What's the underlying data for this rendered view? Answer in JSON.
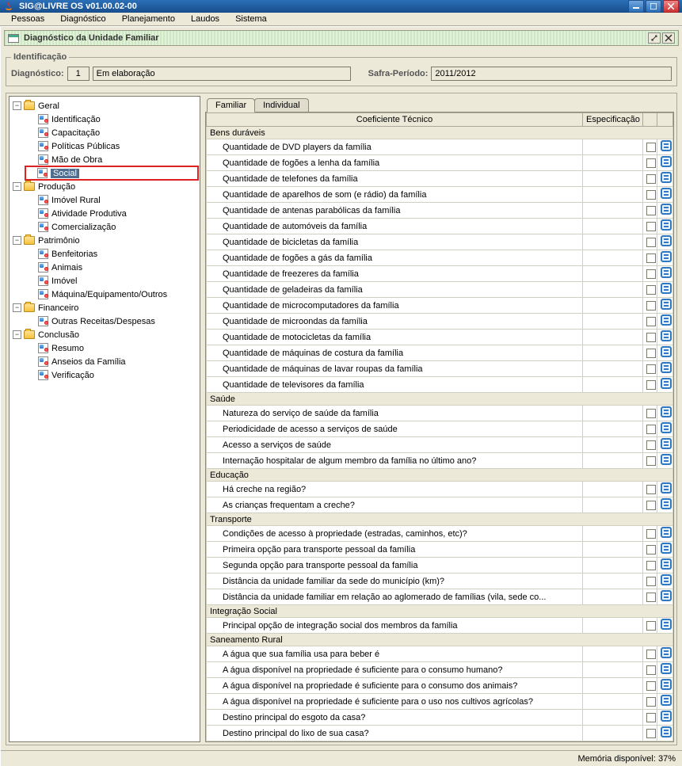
{
  "window": {
    "title": "SIG@LIVRE OS v01.00.02-00"
  },
  "menubar": [
    "Pessoas",
    "Diagnóstico",
    "Planejamento",
    "Laudos",
    "Sistema"
  ],
  "iframe": {
    "title": "Diagnóstico da Unidade Familiar"
  },
  "ident": {
    "legend": "Identificação",
    "diag_label": "Diagnóstico:",
    "diag_num": "1",
    "diag_status": "Em elaboração",
    "safra_label": "Safra-Período:",
    "safra_val": "2011/2012"
  },
  "tree": [
    {
      "label": "Geral",
      "type": "folder",
      "expanded": true,
      "children": [
        {
          "label": "Identificação",
          "type": "doc"
        },
        {
          "label": "Capacitação",
          "type": "doc"
        },
        {
          "label": "Políticas Públicas",
          "type": "doc"
        },
        {
          "label": "Mão de Obra",
          "type": "doc"
        },
        {
          "label": "Social",
          "type": "doc",
          "selected": true,
          "highlight": true
        }
      ]
    },
    {
      "label": "Produção",
      "type": "folder",
      "expanded": true,
      "children": [
        {
          "label": "Imóvel Rural",
          "type": "doc"
        },
        {
          "label": "Atividade Produtiva",
          "type": "doc"
        },
        {
          "label": "Comercialização",
          "type": "doc"
        }
      ]
    },
    {
      "label": "Patrimônio",
      "type": "folder",
      "expanded": true,
      "children": [
        {
          "label": "Benfeitorias",
          "type": "doc"
        },
        {
          "label": "Animais",
          "type": "doc"
        },
        {
          "label": "Imóvel",
          "type": "doc"
        },
        {
          "label": "Máquina/Equipamento/Outros",
          "type": "doc"
        }
      ]
    },
    {
      "label": "Financeiro",
      "type": "folder",
      "expanded": true,
      "children": [
        {
          "label": "Outras Receitas/Despesas",
          "type": "doc"
        }
      ]
    },
    {
      "label": "Conclusão",
      "type": "folder",
      "expanded": true,
      "children": [
        {
          "label": "Resumo",
          "type": "doc"
        },
        {
          "label": "Anseios da Família",
          "type": "doc"
        },
        {
          "label": "Verificação",
          "type": "doc"
        }
      ]
    }
  ],
  "tabs": [
    {
      "label": "Familiar",
      "active": true
    },
    {
      "label": "Individual",
      "active": false
    }
  ],
  "table": {
    "headers": {
      "coef": "Coeficiente Técnico",
      "spec": "Especificação"
    },
    "groups": [
      {
        "name": "Bens duráveis",
        "rows": [
          "Quantidade de DVD players da família",
          "Quantidade de fogões a lenha da família",
          "Quantidade de telefones da família",
          "Quantidade de aparelhos de som (e rádio) da família",
          "Quantidade de antenas parabólicas da família",
          "Quantidade de automóveis da família",
          "Quantidade de bicicletas da família",
          "Quantidade de fogões a gás da família",
          "Quantidade de freezeres da família",
          "Quantidade de geladeiras da família",
          "Quantidade de microcomputadores da família",
          "Quantidade de microondas da família",
          "Quantidade de motocicletas da família",
          "Quantidade de máquinas de costura da família",
          "Quantidade de máquinas de lavar roupas da família",
          "Quantidade de televisores da família"
        ]
      },
      {
        "name": "Saúde",
        "rows": [
          "Natureza do serviço de saúde da família",
          "Periodicidade de acesso a serviços de saúde",
          "Acesso a serviços de saúde",
          "Internação hospitalar de algum membro da família no último ano?"
        ]
      },
      {
        "name": "Educação",
        "rows": [
          "Há creche na região?",
          "As crianças frequentam a creche?"
        ]
      },
      {
        "name": "Transporte",
        "rows": [
          "Condições de acesso à propriedade (estradas, caminhos, etc)?",
          "Primeira opção para transporte pessoal da família",
          "Segunda opção para transporte pessoal da família",
          "Distância da unidade familiar da sede do município (km)?",
          "Distância da unidade familiar em relação ao aglomerado de famílias (vila, sede co..."
        ]
      },
      {
        "name": "Integração Social",
        "rows": [
          "Principal opção de integração social dos membros da família"
        ]
      },
      {
        "name": "Saneamento Rural",
        "rows": [
          "A água que sua família usa para beber é",
          "A água disponível na propriedade é suficiente para o consumo humano?",
          "A água disponível na propriedade é suficiente para o consumo dos animais?",
          "A água disponível na propriedade é suficiente para o uso nos cultivos agrícolas?",
          "Destino principal do esgoto da casa?",
          "Destino principal do lixo de sua casa?"
        ]
      }
    ]
  },
  "status": {
    "memory": "Memória disponível: 37%"
  }
}
